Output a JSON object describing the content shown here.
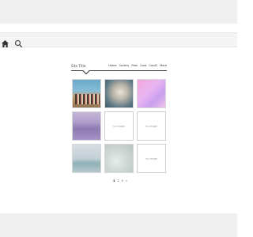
{
  "header": {
    "site_title": "Site Title",
    "nav": [
      "Home",
      "Gallery",
      "Post",
      "Card",
      "Card2",
      "More"
    ]
  },
  "toolbar": {
    "icons": [
      "home-icon",
      "search-icon"
    ]
  },
  "gallery": {
    "placeholder_label": "no image",
    "tiles": [
      {
        "type": "photo"
      },
      {
        "type": "photo"
      },
      {
        "type": "photo"
      },
      {
        "type": "photo"
      },
      {
        "type": "placeholder"
      },
      {
        "type": "placeholder"
      },
      {
        "type": "photo"
      },
      {
        "type": "photo"
      },
      {
        "type": "placeholder"
      }
    ]
  },
  "pagination": {
    "pages": [
      "1",
      "2",
      "3"
    ],
    "next": "»"
  },
  "colors": {
    "band": "#f0f0f0",
    "text": "#333333",
    "tile_border": "#cfcfcf"
  }
}
